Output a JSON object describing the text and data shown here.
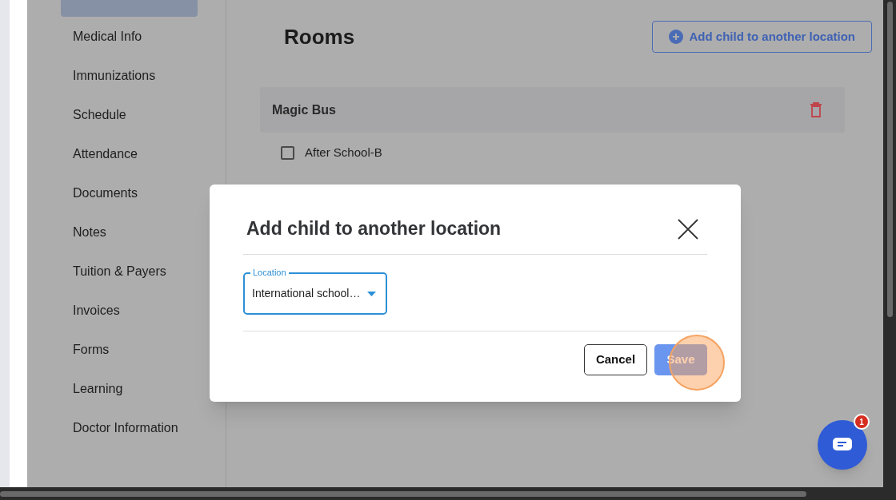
{
  "sidebar": {
    "items": [
      {
        "selected": true
      },
      {
        "label": "Medical Info",
        "selected": false
      },
      {
        "label": "Immunizations",
        "selected": false
      },
      {
        "label": "Schedule",
        "selected": false
      },
      {
        "label": "Attendance",
        "selected": false
      },
      {
        "label": "Documents",
        "selected": false
      },
      {
        "label": "Notes",
        "selected": false
      },
      {
        "label": "Tuition & Payers",
        "selected": false
      },
      {
        "label": "Invoices",
        "selected": false
      },
      {
        "label": "Forms",
        "selected": false
      },
      {
        "label": "Learning",
        "selected": false
      },
      {
        "label": "Doctor Information",
        "selected": false
      }
    ]
  },
  "main": {
    "title": "Rooms",
    "add_button": "Add child to another location",
    "groups": [
      {
        "name": "Magic Bus",
        "rooms": [
          {
            "label": "After School-B",
            "checked": false
          }
        ]
      }
    ]
  },
  "dialog": {
    "title": "Add child to another location",
    "location": {
      "label": "Location",
      "value": "International school…"
    },
    "buttons": [
      {
        "label": "Cancel",
        "kind": "secondary"
      },
      {
        "label": "Save",
        "kind": "primary"
      }
    ]
  },
  "chat": {
    "badge": "1"
  }
}
